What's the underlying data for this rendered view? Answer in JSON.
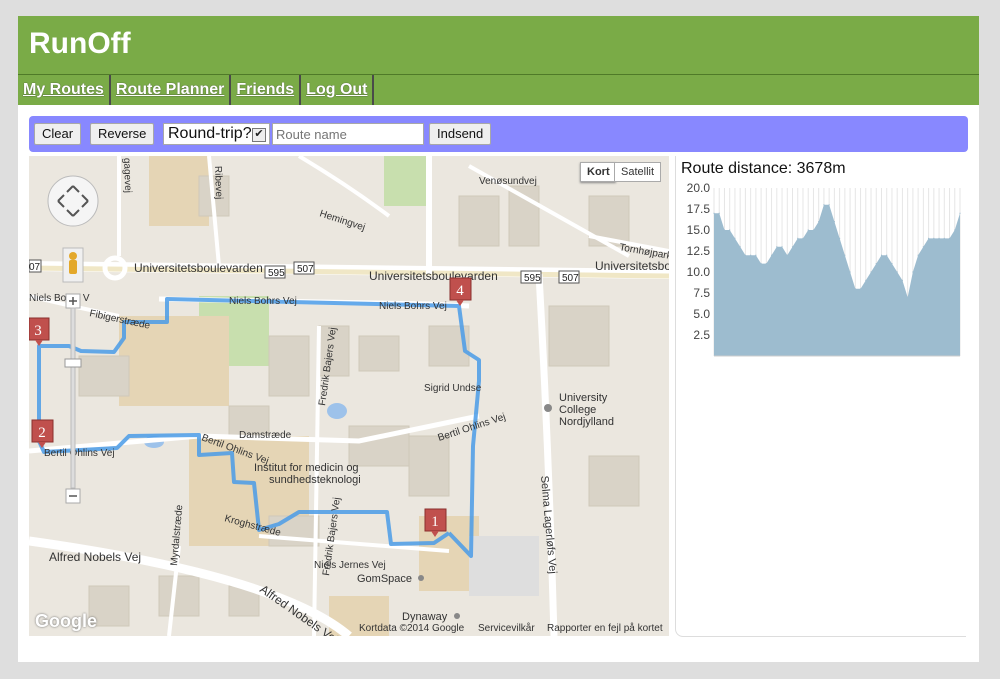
{
  "app": {
    "title": "RunOff"
  },
  "nav": {
    "items": [
      "My Routes",
      "Route Planner",
      "Friends",
      "Log Out"
    ]
  },
  "toolbar": {
    "clear_label": "Clear",
    "reverse_label": "Reverse",
    "roundtrip_label": "Round-trip?",
    "roundtrip_checked": "✔",
    "route_name_placeholder": "Route name",
    "route_name_value": "",
    "submit_label": "Indsend"
  },
  "map": {
    "type_buttons": [
      "Kort",
      "Satellit"
    ],
    "markers": [
      "1",
      "2",
      "3",
      "4"
    ],
    "road_badges": [
      "595",
      "507",
      "595",
      "507"
    ],
    "edge_badge": "07",
    "labels": {
      "universitetsboulevarden": "Universitetsboulevarden",
      "universitetsboulevarden_2": "Universitetsboulevarden",
      "universitetsbou": "Universitetsbou",
      "niels_bohrs_vej_1": "Niels Bohrs Vej",
      "niels_bohrs_vej_2": "Niels Bohrs Vej",
      "niels_bohrs_vej_3": "Niels Bohrs V",
      "fibigerstraede": "Fibigerstræde",
      "bertil_ohlins_vej_1": "Bertil Ohlins Vej",
      "bertil_ohlins_vej_2": "Bertil Ohlins Vej",
      "bertil_ohlins_vej_3": "Bertil Ohlins Vej",
      "damstraede": "Damstræde",
      "fredrik_bajers_vej_1": "Fredrik Bajers Vej",
      "fredrik_bajers_vej_2": "Fredrik Bajers Vej",
      "institut_1": "Institut for medicin og",
      "institut_2": "sundhedsteknologi",
      "kroghstraede": "Kroghstræde",
      "myrdalstraede": "Myrdalstræde",
      "alfred_nobels_vej_1": "Alfred Nobels Vej",
      "alfred_nobels_vej_2": "Alfred Nobels Vej",
      "niels_jernes_vej": "Niels Jernes Vej",
      "gomspace": "GomSpace",
      "dynaway": "Dynaway",
      "selma": "Selma Lagerløfs Vej",
      "university_college_1": "University",
      "university_college_2": "College",
      "university_college_3": "Nordjylland",
      "sigrid_undset": "Sigrid Undse",
      "ribevej": "Ribevej",
      "hemingvej": "Hemingvej",
      "venosundvej": "Venøsundvej",
      "tornhojpark": "Tornhøjpark",
      "gaagevej": "gagevej",
      "kortdata": "Kortdata ©2014 Google",
      "servicevilkar": "Servicevilkår",
      "rapporter": "Rapporter en fejl på kortet",
      "google": "Google"
    }
  },
  "elevation": {
    "route_distance_label": "Route distance: 3678m",
    "chart_data": {
      "type": "area",
      "ylim": [
        0,
        20
      ],
      "yticks": [
        "20.0",
        "17.5",
        "15.0",
        "12.5",
        "10.0",
        "7.5",
        "5.0",
        "2.5"
      ],
      "values": [
        17,
        17,
        15,
        15,
        14,
        13,
        12,
        12,
        12,
        11,
        11,
        12,
        13,
        13,
        12,
        13,
        14,
        14,
        15,
        15,
        16,
        18,
        18,
        16,
        14,
        12,
        10,
        8,
        8,
        9,
        10,
        11,
        12,
        12,
        11,
        10,
        9,
        7,
        10,
        12,
        13,
        14,
        14,
        14,
        14,
        14,
        15,
        17
      ],
      "colors": {
        "fill": "#9dbccf",
        "grid": "#e6e6e6",
        "axis": "#cccccc"
      }
    }
  },
  "colors": {
    "header": "#7aab47",
    "toolbar": "#8888ff",
    "route": "#4a9be8",
    "marker": "#c0504d"
  }
}
